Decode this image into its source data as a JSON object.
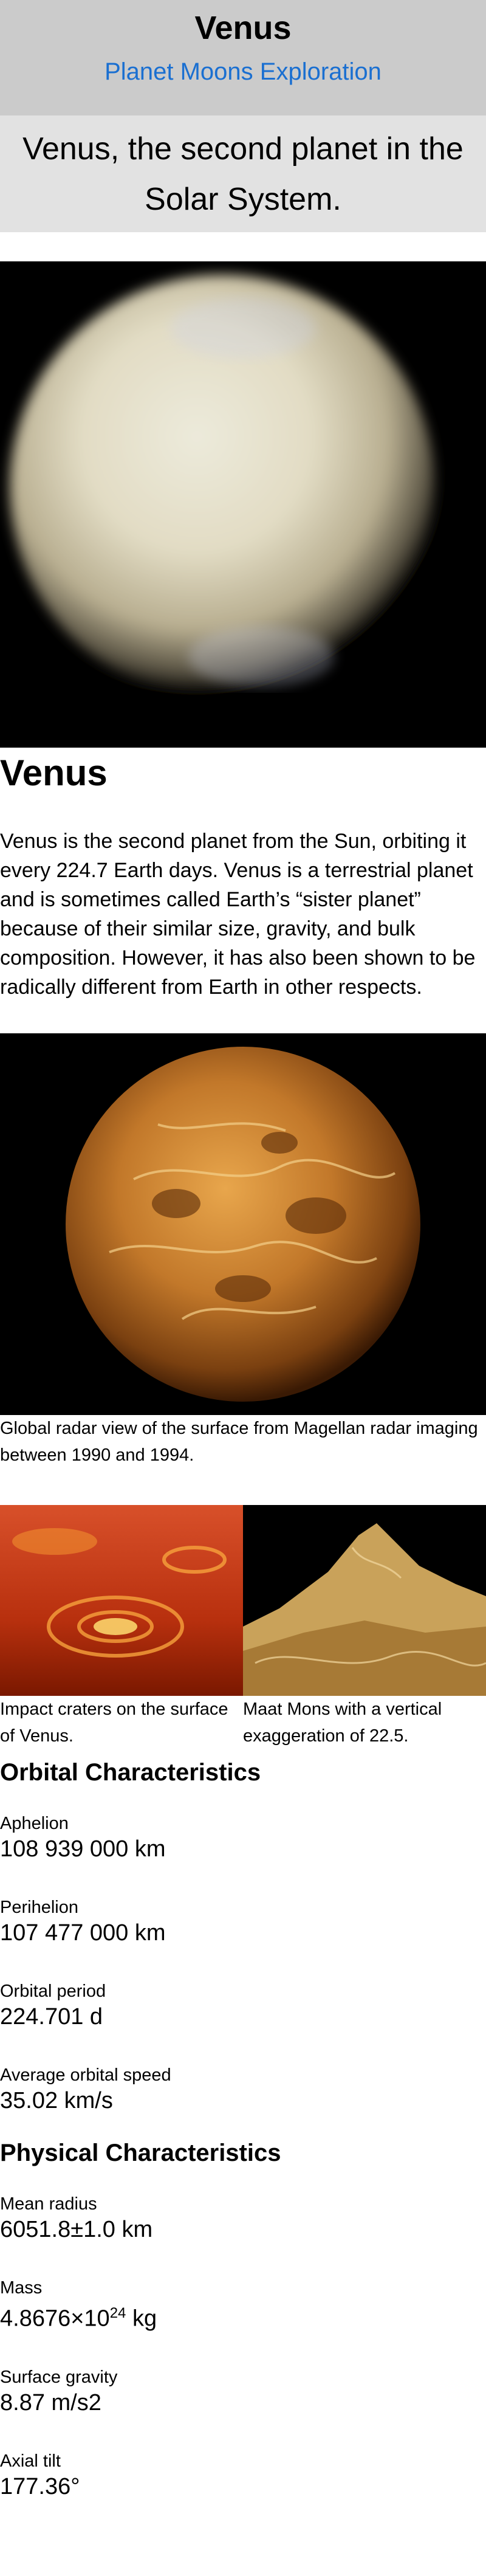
{
  "header": {
    "title": "Venus",
    "nav_label": "Planet Moons Exploration"
  },
  "hero": {
    "text": "Venus, the second planet in the Solar System."
  },
  "article": {
    "heading": "Venus",
    "intro": "Venus is the second planet from the Sun, orbiting it every 224.7 Earth days. Venus is a terrestrial planet and is sometimes called Earth’s “sister planet” because of their similar size, gravity, and bulk composition. However, it has also been shown to be radically different from Earth in other respects."
  },
  "figures": {
    "radar_caption": "Global radar view of the surface from Magellan radar imaging between 1990 and 1994.",
    "craters_caption": "Impact craters on the surface of Venus.",
    "maat_caption": "Maat Mons with a vertical exaggeration of 22.5."
  },
  "orbital": {
    "heading": "Orbital Characteristics",
    "items": [
      {
        "label": "Aphelion",
        "value": "108 939 000 km"
      },
      {
        "label": "Perihelion",
        "value": "107 477 000 km"
      },
      {
        "label": "Orbital period",
        "value": "224.701 d"
      },
      {
        "label": "Average orbital speed",
        "value": "35.02 km/s"
      }
    ]
  },
  "physical": {
    "heading": "Physical Characteristics",
    "items": [
      {
        "label": "Mean radius",
        "value": "6051.8±1.0 km"
      },
      {
        "label": "Mass",
        "value_base": "4.8676×10",
        "value_exp": "24",
        "value_unit": " kg"
      },
      {
        "label": "Surface gravity",
        "value": "8.87 m/s2"
      },
      {
        "label": "Axial tilt",
        "value": "177.36°"
      }
    ]
  }
}
